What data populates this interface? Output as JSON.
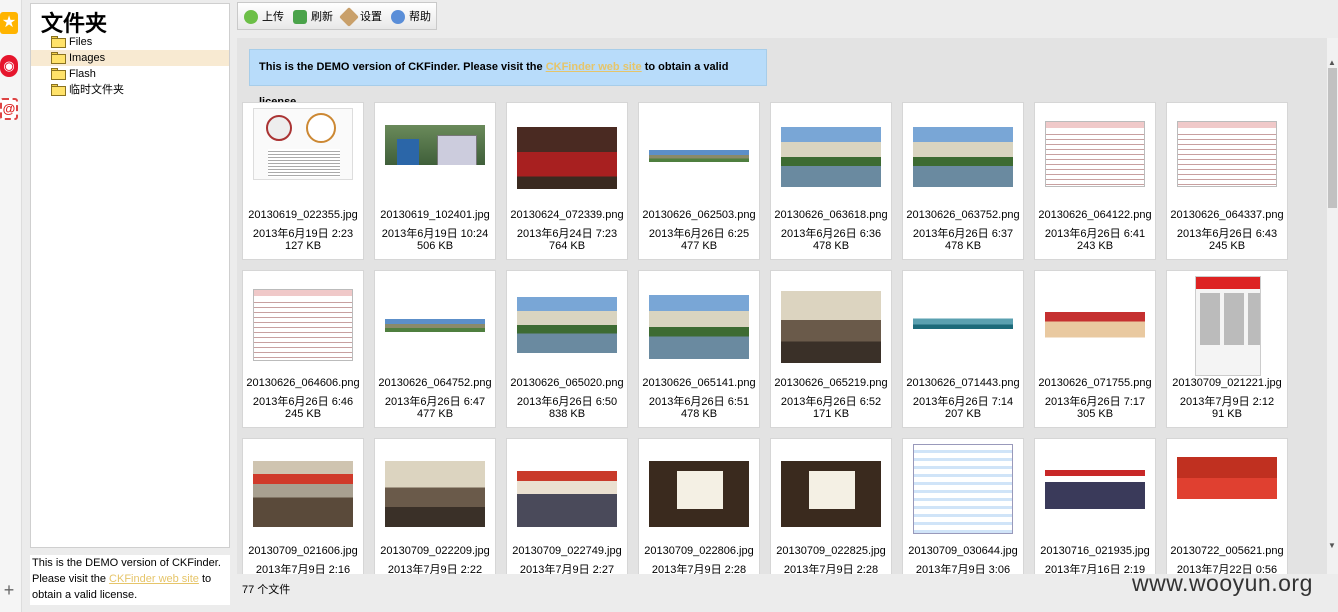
{
  "left_strip": {
    "icons": [
      "star-icon",
      "weibo-icon",
      "mail-icon",
      "plus-icon"
    ]
  },
  "folders": {
    "title": "文件夹",
    "items": [
      {
        "label": "Files",
        "selected": false
      },
      {
        "label": "Images",
        "selected": true
      },
      {
        "label": "Flash",
        "selected": false
      },
      {
        "label": "临时文件夹",
        "selected": false
      }
    ]
  },
  "demo_left": {
    "text1": "This is the DEMO version of CKFinder.",
    "text2": "Please visit the ",
    "link": "CKFinder web site",
    "text3": " to obtain a valid license."
  },
  "toolbar": {
    "upload": "上传",
    "refresh": "刷新",
    "settings": "设置",
    "help": "帮助"
  },
  "banner": {
    "text1": "This is the DEMO version of CKFinder. Please visit the ",
    "link": "CKFinder web site",
    "text2": " to obtain a valid license."
  },
  "files": [
    {
      "name": "20130619_022355.jpg",
      "date": "2013年6月19日 2:23",
      "size": "127 KB"
    },
    {
      "name": "20130619_102401.jpg",
      "date": "2013年6月19日 10:24",
      "size": "506 KB"
    },
    {
      "name": "20130624_072339.png",
      "date": "2013年6月24日 7:23",
      "size": "764 KB"
    },
    {
      "name": "20130626_062503.png",
      "date": "2013年6月26日 6:25",
      "size": "477 KB"
    },
    {
      "name": "20130626_063618.png",
      "date": "2013年6月26日 6:36",
      "size": "478 KB"
    },
    {
      "name": "20130626_063752.png",
      "date": "2013年6月26日 6:37",
      "size": "478 KB"
    },
    {
      "name": "20130626_064122.png",
      "date": "2013年6月26日 6:41",
      "size": "243 KB"
    },
    {
      "name": "20130626_064337.png",
      "date": "2013年6月26日 6:43",
      "size": "245 KB"
    },
    {
      "name": "20130626_064606.png",
      "date": "2013年6月26日 6:46",
      "size": "245 KB"
    },
    {
      "name": "20130626_064752.png",
      "date": "2013年6月26日 6:47",
      "size": "477 KB"
    },
    {
      "name": "20130626_065020.png",
      "date": "2013年6月26日 6:50",
      "size": "838 KB"
    },
    {
      "name": "20130626_065141.png",
      "date": "2013年6月26日 6:51",
      "size": "478 KB"
    },
    {
      "name": "20130626_065219.png",
      "date": "2013年6月26日 6:52",
      "size": "171 KB"
    },
    {
      "name": "20130626_071443.png",
      "date": "2013年6月26日 7:14",
      "size": "207 KB"
    },
    {
      "name": "20130626_071755.png",
      "date": "2013年6月26日 7:17",
      "size": "305 KB"
    },
    {
      "name": "20130709_021221.jpg",
      "date": "2013年7月9日 2:12",
      "size": "91 KB"
    },
    {
      "name": "20130709_021606.jpg",
      "date": "2013年7月9日 2:16",
      "size": ""
    },
    {
      "name": "20130709_022209.jpg",
      "date": "2013年7月9日 2:22",
      "size": ""
    },
    {
      "name": "20130709_022749.jpg",
      "date": "2013年7月9日 2:27",
      "size": ""
    },
    {
      "name": "20130709_022806.jpg",
      "date": "2013年7月9日 2:28",
      "size": ""
    },
    {
      "name": "20130709_022825.jpg",
      "date": "2013年7月9日 2:28",
      "size": ""
    },
    {
      "name": "20130709_030644.jpg",
      "date": "2013年7月9日 3:06",
      "size": ""
    },
    {
      "name": "20130716_021935.jpg",
      "date": "2013年7月16日 2:19",
      "size": ""
    },
    {
      "name": "20130722_005621.png",
      "date": "2013年7月22日 0:56",
      "size": ""
    }
  ],
  "status": {
    "count": "77 个文件"
  },
  "watermark": "www.wooyun.org"
}
